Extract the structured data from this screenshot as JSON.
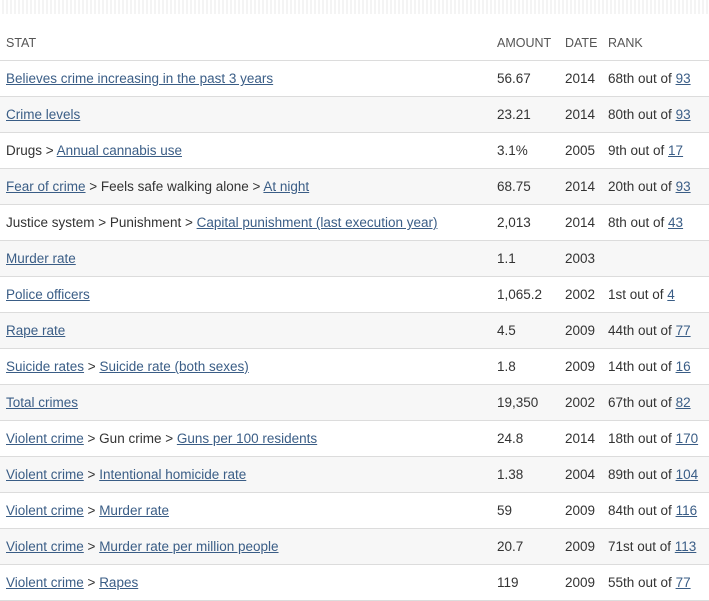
{
  "columns": {
    "stat": "STAT",
    "amount": "AMOUNT",
    "date": "DATE",
    "rank": "RANK"
  },
  "rows": [
    {
      "stat": [
        {
          "text": "Believes crime increasing in the past 3 years",
          "link": true
        }
      ],
      "amount": "56.67",
      "date": "2014",
      "rank_prefix": "68th out of ",
      "rank_total": "93"
    },
    {
      "stat": [
        {
          "text": "Crime levels",
          "link": true
        }
      ],
      "amount": "23.21",
      "date": "2014",
      "rank_prefix": "80th out of ",
      "rank_total": "93"
    },
    {
      "stat": [
        {
          "text": "Drugs > ",
          "link": false
        },
        {
          "text": "Annual cannabis use",
          "link": true
        }
      ],
      "amount": "3.1%",
      "date": "2005",
      "rank_prefix": "9th out of ",
      "rank_total": "17"
    },
    {
      "stat": [
        {
          "text": "Fear of crime",
          "link": true
        },
        {
          "text": " > Feels safe walking alone > ",
          "link": false
        },
        {
          "text": "At night",
          "link": true
        }
      ],
      "amount": "68.75",
      "date": "2014",
      "rank_prefix": "20th out of ",
      "rank_total": "93"
    },
    {
      "stat": [
        {
          "text": "Justice system > Punishment > ",
          "link": false
        },
        {
          "text": "Capital punishment (last execution year)",
          "link": true
        }
      ],
      "amount": "2,013",
      "date": "2014",
      "rank_prefix": "8th out of ",
      "rank_total": "43"
    },
    {
      "stat": [
        {
          "text": "Murder rate",
          "link": true
        }
      ],
      "amount": "1.1",
      "date": "2003",
      "rank_prefix": "",
      "rank_total": ""
    },
    {
      "stat": [
        {
          "text": "Police officers",
          "link": true
        }
      ],
      "amount": "1,065.2",
      "date": "2002",
      "rank_prefix": "1st out of ",
      "rank_total": "4"
    },
    {
      "stat": [
        {
          "text": "Rape rate",
          "link": true
        }
      ],
      "amount": "4.5",
      "date": "2009",
      "rank_prefix": "44th out of ",
      "rank_total": "77"
    },
    {
      "stat": [
        {
          "text": "Suicide rates",
          "link": true
        },
        {
          "text": " > ",
          "link": false
        },
        {
          "text": "Suicide rate (both sexes)",
          "link": true
        }
      ],
      "amount": "1.8",
      "date": "2009",
      "rank_prefix": "14th out of ",
      "rank_total": "16"
    },
    {
      "stat": [
        {
          "text": "Total crimes",
          "link": true
        }
      ],
      "amount": "19,350",
      "date": "2002",
      "rank_prefix": "67th out of ",
      "rank_total": "82"
    },
    {
      "stat": [
        {
          "text": "Violent crime",
          "link": true
        },
        {
          "text": " > Gun crime > ",
          "link": false
        },
        {
          "text": "Guns per 100 residents",
          "link": true
        }
      ],
      "amount": "24.8",
      "date": "2014",
      "rank_prefix": "18th out of ",
      "rank_total": "170"
    },
    {
      "stat": [
        {
          "text": "Violent crime",
          "link": true
        },
        {
          "text": " > ",
          "link": false
        },
        {
          "text": "Intentional homicide rate",
          "link": true
        }
      ],
      "amount": "1.38",
      "date": "2004",
      "rank_prefix": "89th out of ",
      "rank_total": "104"
    },
    {
      "stat": [
        {
          "text": "Violent crime",
          "link": true
        },
        {
          "text": " > ",
          "link": false
        },
        {
          "text": "Murder rate",
          "link": true
        }
      ],
      "amount": "59",
      "date": "2009",
      "rank_prefix": "84th out of ",
      "rank_total": "116"
    },
    {
      "stat": [
        {
          "text": "Violent crime",
          "link": true
        },
        {
          "text": " > ",
          "link": false
        },
        {
          "text": "Murder rate per million people",
          "link": true
        }
      ],
      "amount": "20.7",
      "date": "2009",
      "rank_prefix": "71st out of ",
      "rank_total": "113"
    },
    {
      "stat": [
        {
          "text": "Violent crime",
          "link": true
        },
        {
          "text": " > ",
          "link": false
        },
        {
          "text": "Rapes",
          "link": true
        }
      ],
      "amount": "119",
      "date": "2009",
      "rank_prefix": "55th out of ",
      "rank_total": "77"
    }
  ]
}
